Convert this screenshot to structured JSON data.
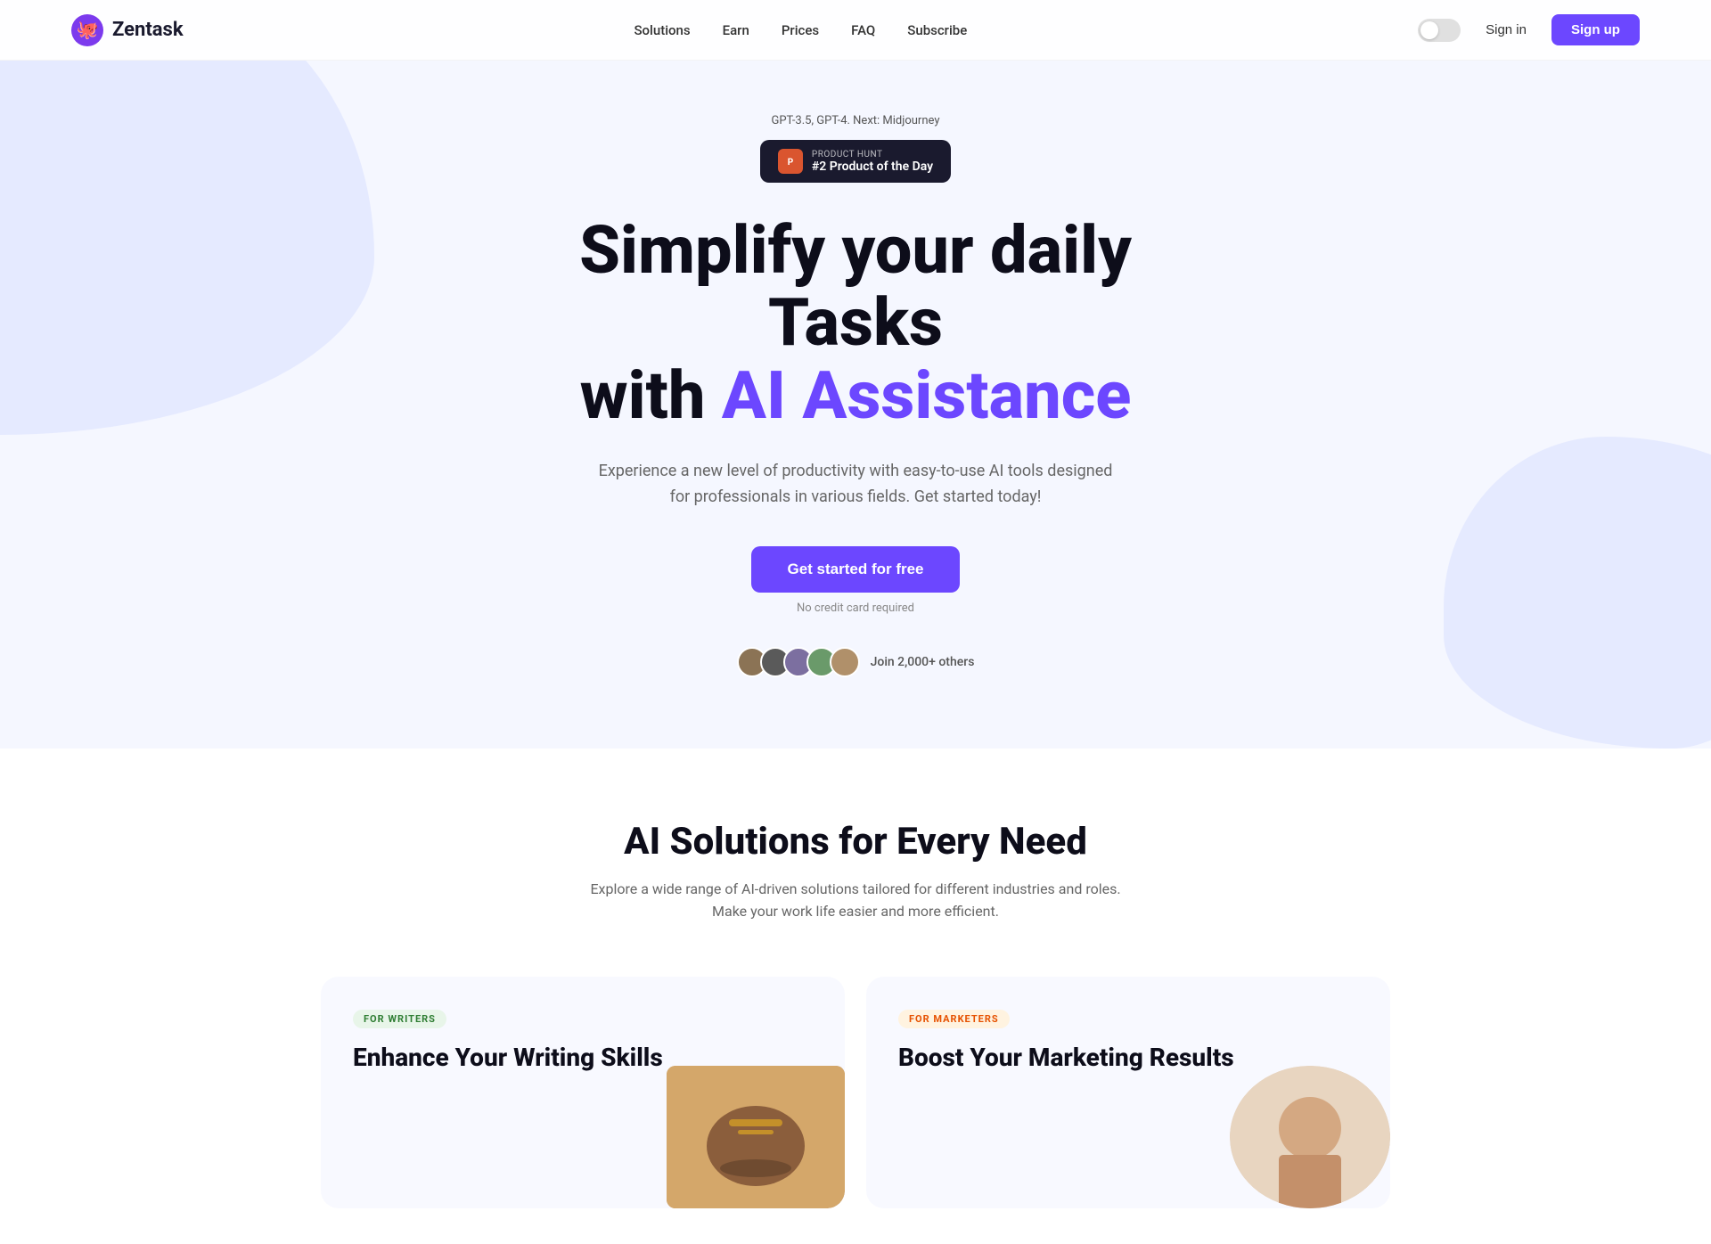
{
  "brand": {
    "logo_text": "Zentask",
    "logo_emoji": "🐙"
  },
  "nav": {
    "links": [
      {
        "label": "Solutions",
        "href": "#"
      },
      {
        "label": "Earn",
        "href": "#"
      },
      {
        "label": "Prices",
        "href": "#"
      },
      {
        "label": "FAQ",
        "href": "#"
      },
      {
        "label": "Subscribe",
        "href": "#"
      }
    ],
    "signin_label": "Sign in",
    "signup_label": "Sign up"
  },
  "hero": {
    "gpt_text": "GPT-3.5, GPT-4. Next: Midjourney",
    "ph_label": "PRODUCT HUNT",
    "ph_title": "#2 Product of the Day",
    "title_line1": "Simplify your daily Tasks",
    "title_line2_plain": "with ",
    "title_line2_accent": "AI Assistance",
    "subtitle": "Experience a new level of productivity with easy-to-use AI tools designed for professionals in various fields. Get started today!",
    "cta_label": "Get started for free",
    "no_credit_text": "No credit card required",
    "social_text": "Join 2,000+ others"
  },
  "solutions": {
    "title": "AI Solutions for Every Need",
    "subtitle": "Explore a wide range of AI-driven solutions tailored for different industries and roles. Make your work life easier and more efficient.",
    "cards": [
      {
        "badge": "FOR WRITERS",
        "badge_class": "badge-writers",
        "title": "Enhance Your Writing Skills"
      },
      {
        "badge": "FOR MARKETERS",
        "badge_class": "badge-marketers",
        "title": "Boost Your Marketing Results"
      }
    ]
  }
}
